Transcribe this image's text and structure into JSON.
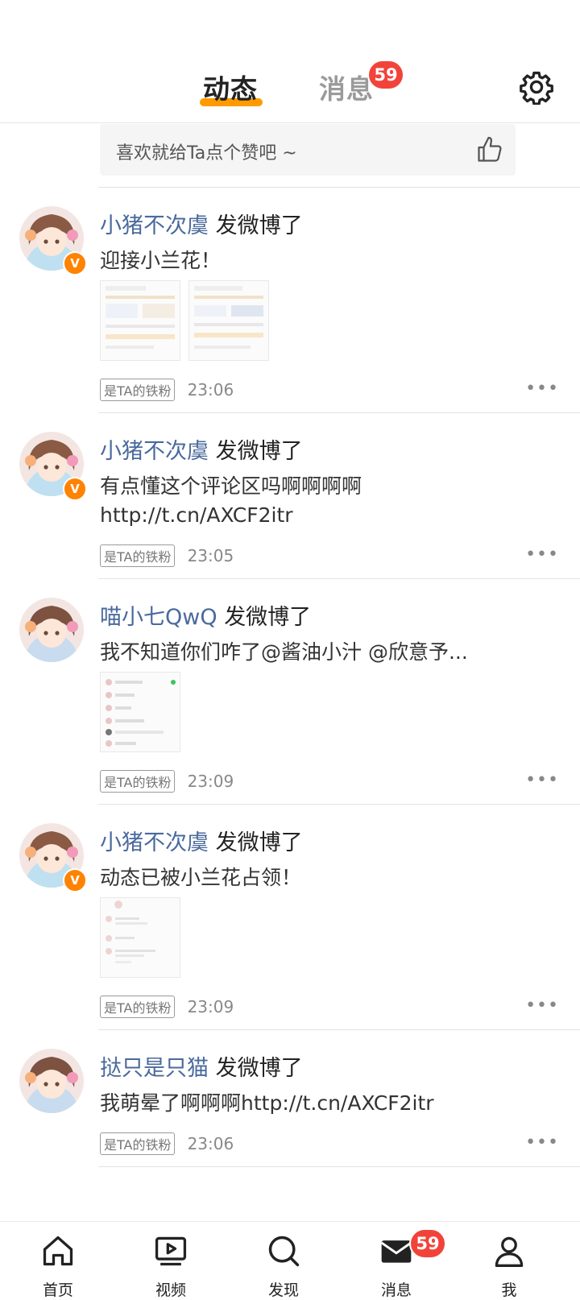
{
  "header": {
    "tabs": [
      {
        "label": "动态",
        "active": true
      },
      {
        "label": "消息",
        "active": false,
        "badge": "59"
      }
    ],
    "settings_icon": "gear-icon"
  },
  "like_bar": {
    "text": "喜欢就给Ta点个赞吧 ~",
    "icon": "thumbs-up-icon"
  },
  "feed": [
    {
      "user": "小猪不次虞",
      "action": "发微博了",
      "text": "迎接小兰花！",
      "verified": true,
      "images": 2,
      "fan_tag": "是TA的铁粉",
      "time": "23:06"
    },
    {
      "user": "小猪不次虞",
      "action": "发微博了",
      "text": "有点懂这个评论区吗啊啊啊啊",
      "link": "http://t.cn/AXCF2itr",
      "verified": true,
      "images": 0,
      "fan_tag": "是TA的铁粉",
      "time": "23:05"
    },
    {
      "user": "喵小七QwQ",
      "action": "发微博了",
      "text": "我不知道你们咋了@酱油小汁 @欣意予...",
      "verified": false,
      "images": 1,
      "fan_tag": "是TA的铁粉",
      "time": "23:09"
    },
    {
      "user": "小猪不次虞",
      "action": "发微博了",
      "text": "动态已被小兰花占领！",
      "verified": true,
      "images": 1,
      "fan_tag": "是TA的铁粉",
      "time": "23:09"
    },
    {
      "user": "挞只是只猫",
      "action": "发微博了",
      "text": "我萌晕了啊啊啊http://t.cn/AXCF2itr",
      "verified": false,
      "images": 0,
      "fan_tag": "是TA的铁粉",
      "time": "23:06"
    }
  ],
  "more_label": "•••",
  "verified_mark": "V",
  "bottom_nav": {
    "items": [
      {
        "label": "首页",
        "icon": "home-icon"
      },
      {
        "label": "视频",
        "icon": "video-icon"
      },
      {
        "label": "发现",
        "icon": "search-icon"
      },
      {
        "label": "消息",
        "icon": "mail-icon",
        "badge": "59"
      },
      {
        "label": "我",
        "icon": "profile-icon"
      }
    ]
  },
  "colors": {
    "accent": "#ff9a00",
    "badge": "#f2433a",
    "username": "#4a6a9c",
    "verified": "#ff8200"
  }
}
